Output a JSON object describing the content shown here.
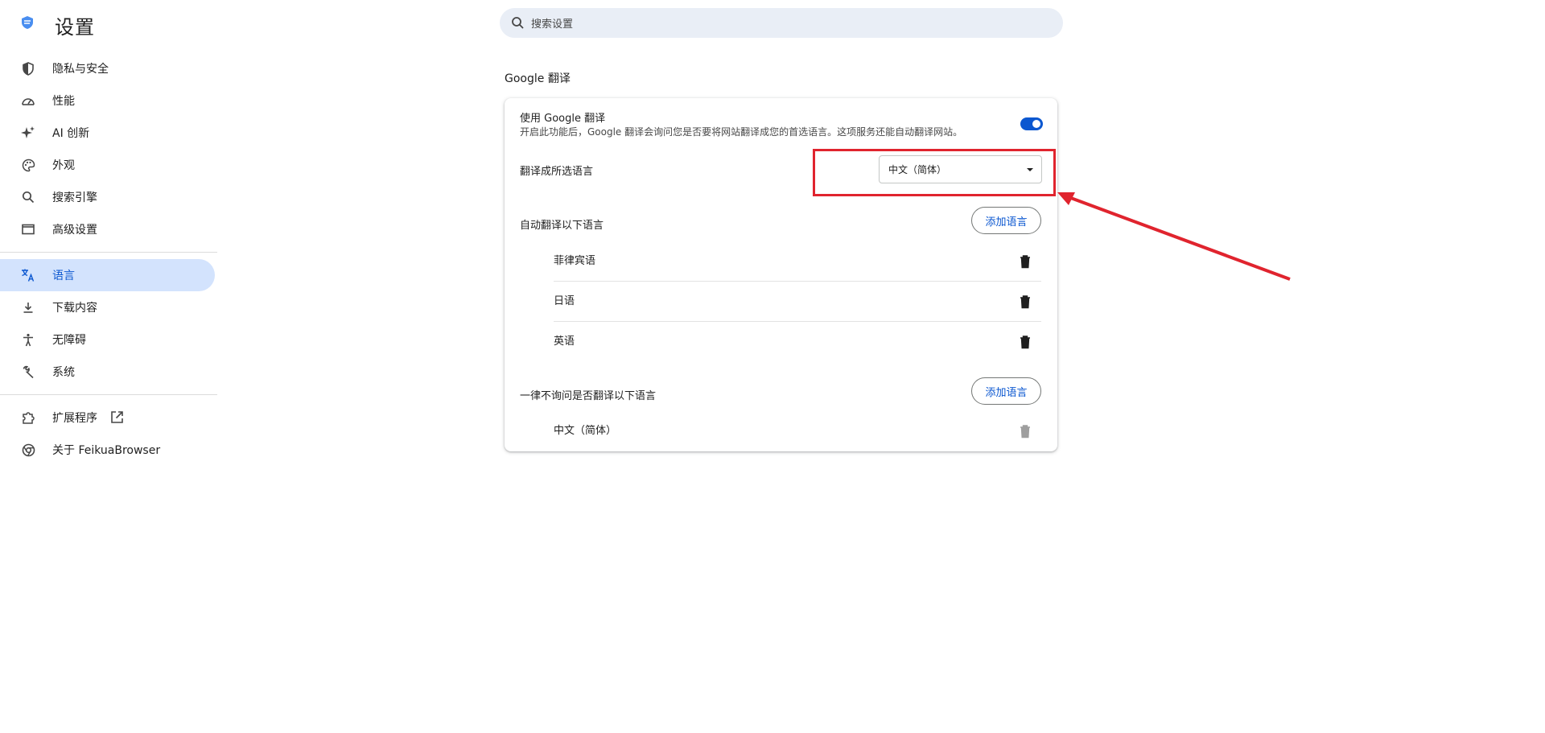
{
  "app": {
    "title": "设置"
  },
  "search": {
    "placeholder": "搜索设置"
  },
  "sidebar": {
    "items": [
      {
        "label": "隐私与安全",
        "icon": "shield-icon"
      },
      {
        "label": "性能",
        "icon": "speedometer-icon"
      },
      {
        "label": "AI 创新",
        "icon": "sparkle-icon"
      },
      {
        "label": "外观",
        "icon": "palette-icon"
      },
      {
        "label": "搜索引擎",
        "icon": "search-icon"
      },
      {
        "label": "高级设置",
        "icon": "window-icon"
      },
      {
        "label": "语言",
        "icon": "translate-icon",
        "active": true
      },
      {
        "label": "下载内容",
        "icon": "download-icon"
      },
      {
        "label": "无障碍",
        "icon": "accessibility-icon"
      },
      {
        "label": "系统",
        "icon": "wrench-icon"
      },
      {
        "label": "扩展程序",
        "icon": "puzzle-icon",
        "external": true
      },
      {
        "label": "关于 FeikuaBrowser",
        "icon": "browser-logo-icon"
      }
    ]
  },
  "main": {
    "section_title": "Google 翻译",
    "use_translate": {
      "label": "使用 Google 翻译",
      "description": "开启此功能后，Google 翻译会询问您是否要将网站翻译成您的首选语言。这项服务还能自动翻译网站。",
      "enabled": true
    },
    "target_language": {
      "label": "翻译成所选语言",
      "value": "中文（简体）"
    },
    "auto_translate": {
      "label": "自动翻译以下语言",
      "add_button": "添加语言",
      "languages": [
        "菲律宾语",
        "日语",
        "英语"
      ]
    },
    "never_ask": {
      "label": "一律不询问是否翻译以下语言",
      "add_button": "添加语言",
      "languages": [
        "中文（简体）"
      ]
    }
  },
  "colors": {
    "accent": "#0b57d0",
    "active_nav_bg": "#d3e3fd",
    "search_bg": "#e9eef6",
    "annotation": "#e0242e"
  }
}
